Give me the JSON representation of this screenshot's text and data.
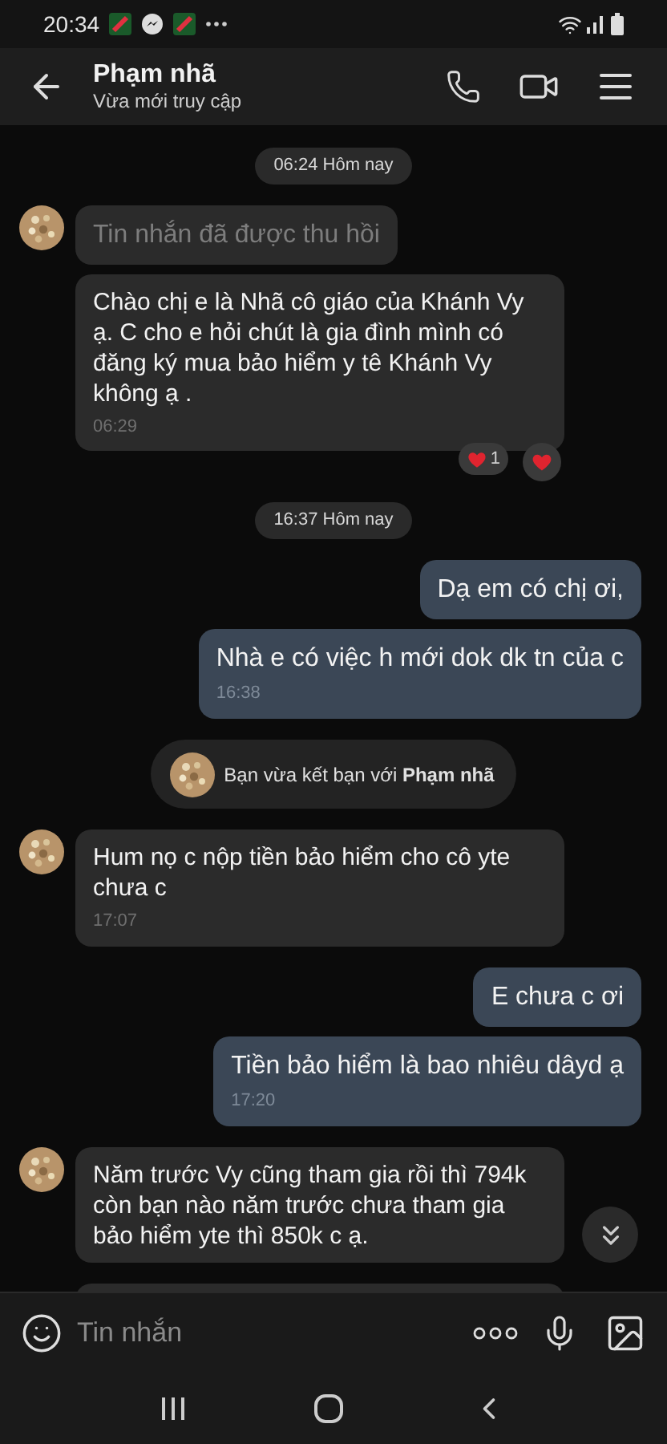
{
  "status_bar": {
    "time": "20:34"
  },
  "header": {
    "name": "Phạm nhã",
    "status": "Vừa mới truy cập"
  },
  "messages": [
    {
      "kind": "time",
      "text": "06:24 Hôm nay"
    },
    {
      "kind": "in",
      "avatar": true,
      "recalled": true,
      "text": "Tin nhắn đã được thu hồi"
    },
    {
      "kind": "in",
      "avatar": false,
      "recalled": false,
      "text": "Chào chị e là Nhã cô giáo của Khánh Vy ạ. C cho e hỏi chút là gia đình mình có đăng ký mua bảo hiểm y tê Khánh Vy không ạ .",
      "time": "06:29",
      "reaction_count": "1"
    },
    {
      "kind": "time",
      "text": "16:37 Hôm nay"
    },
    {
      "kind": "out",
      "text": "Dạ em có chị ơi,"
    },
    {
      "kind": "out",
      "text": "Nhà e có việc h mới dok dk tn của c",
      "time": "16:38"
    },
    {
      "kind": "system",
      "text": "Bạn vừa kết bạn với **Phạm nhã**"
    },
    {
      "kind": "in",
      "avatar": true,
      "recalled": false,
      "text": "Hum nọ c nộp tiền bảo hiểm cho cô yte chưa c",
      "time": "17:07"
    },
    {
      "kind": "out",
      "text": "E chưa c ơi"
    },
    {
      "kind": "out",
      "text": "Tiền bảo hiểm là bao nhiêu dâyd ạ",
      "time": "17:20"
    },
    {
      "kind": "in",
      "avatar": true,
      "recalled": false,
      "text": " Năm trước Vy cũng tham gia rồi thì 794k còn bạn nào năm trước chưa tham gia bảo hiểm yte thì 850k c ạ."
    },
    {
      "kind": "partial"
    }
  ],
  "composer": {
    "placeholder": "Tin nhắn"
  }
}
